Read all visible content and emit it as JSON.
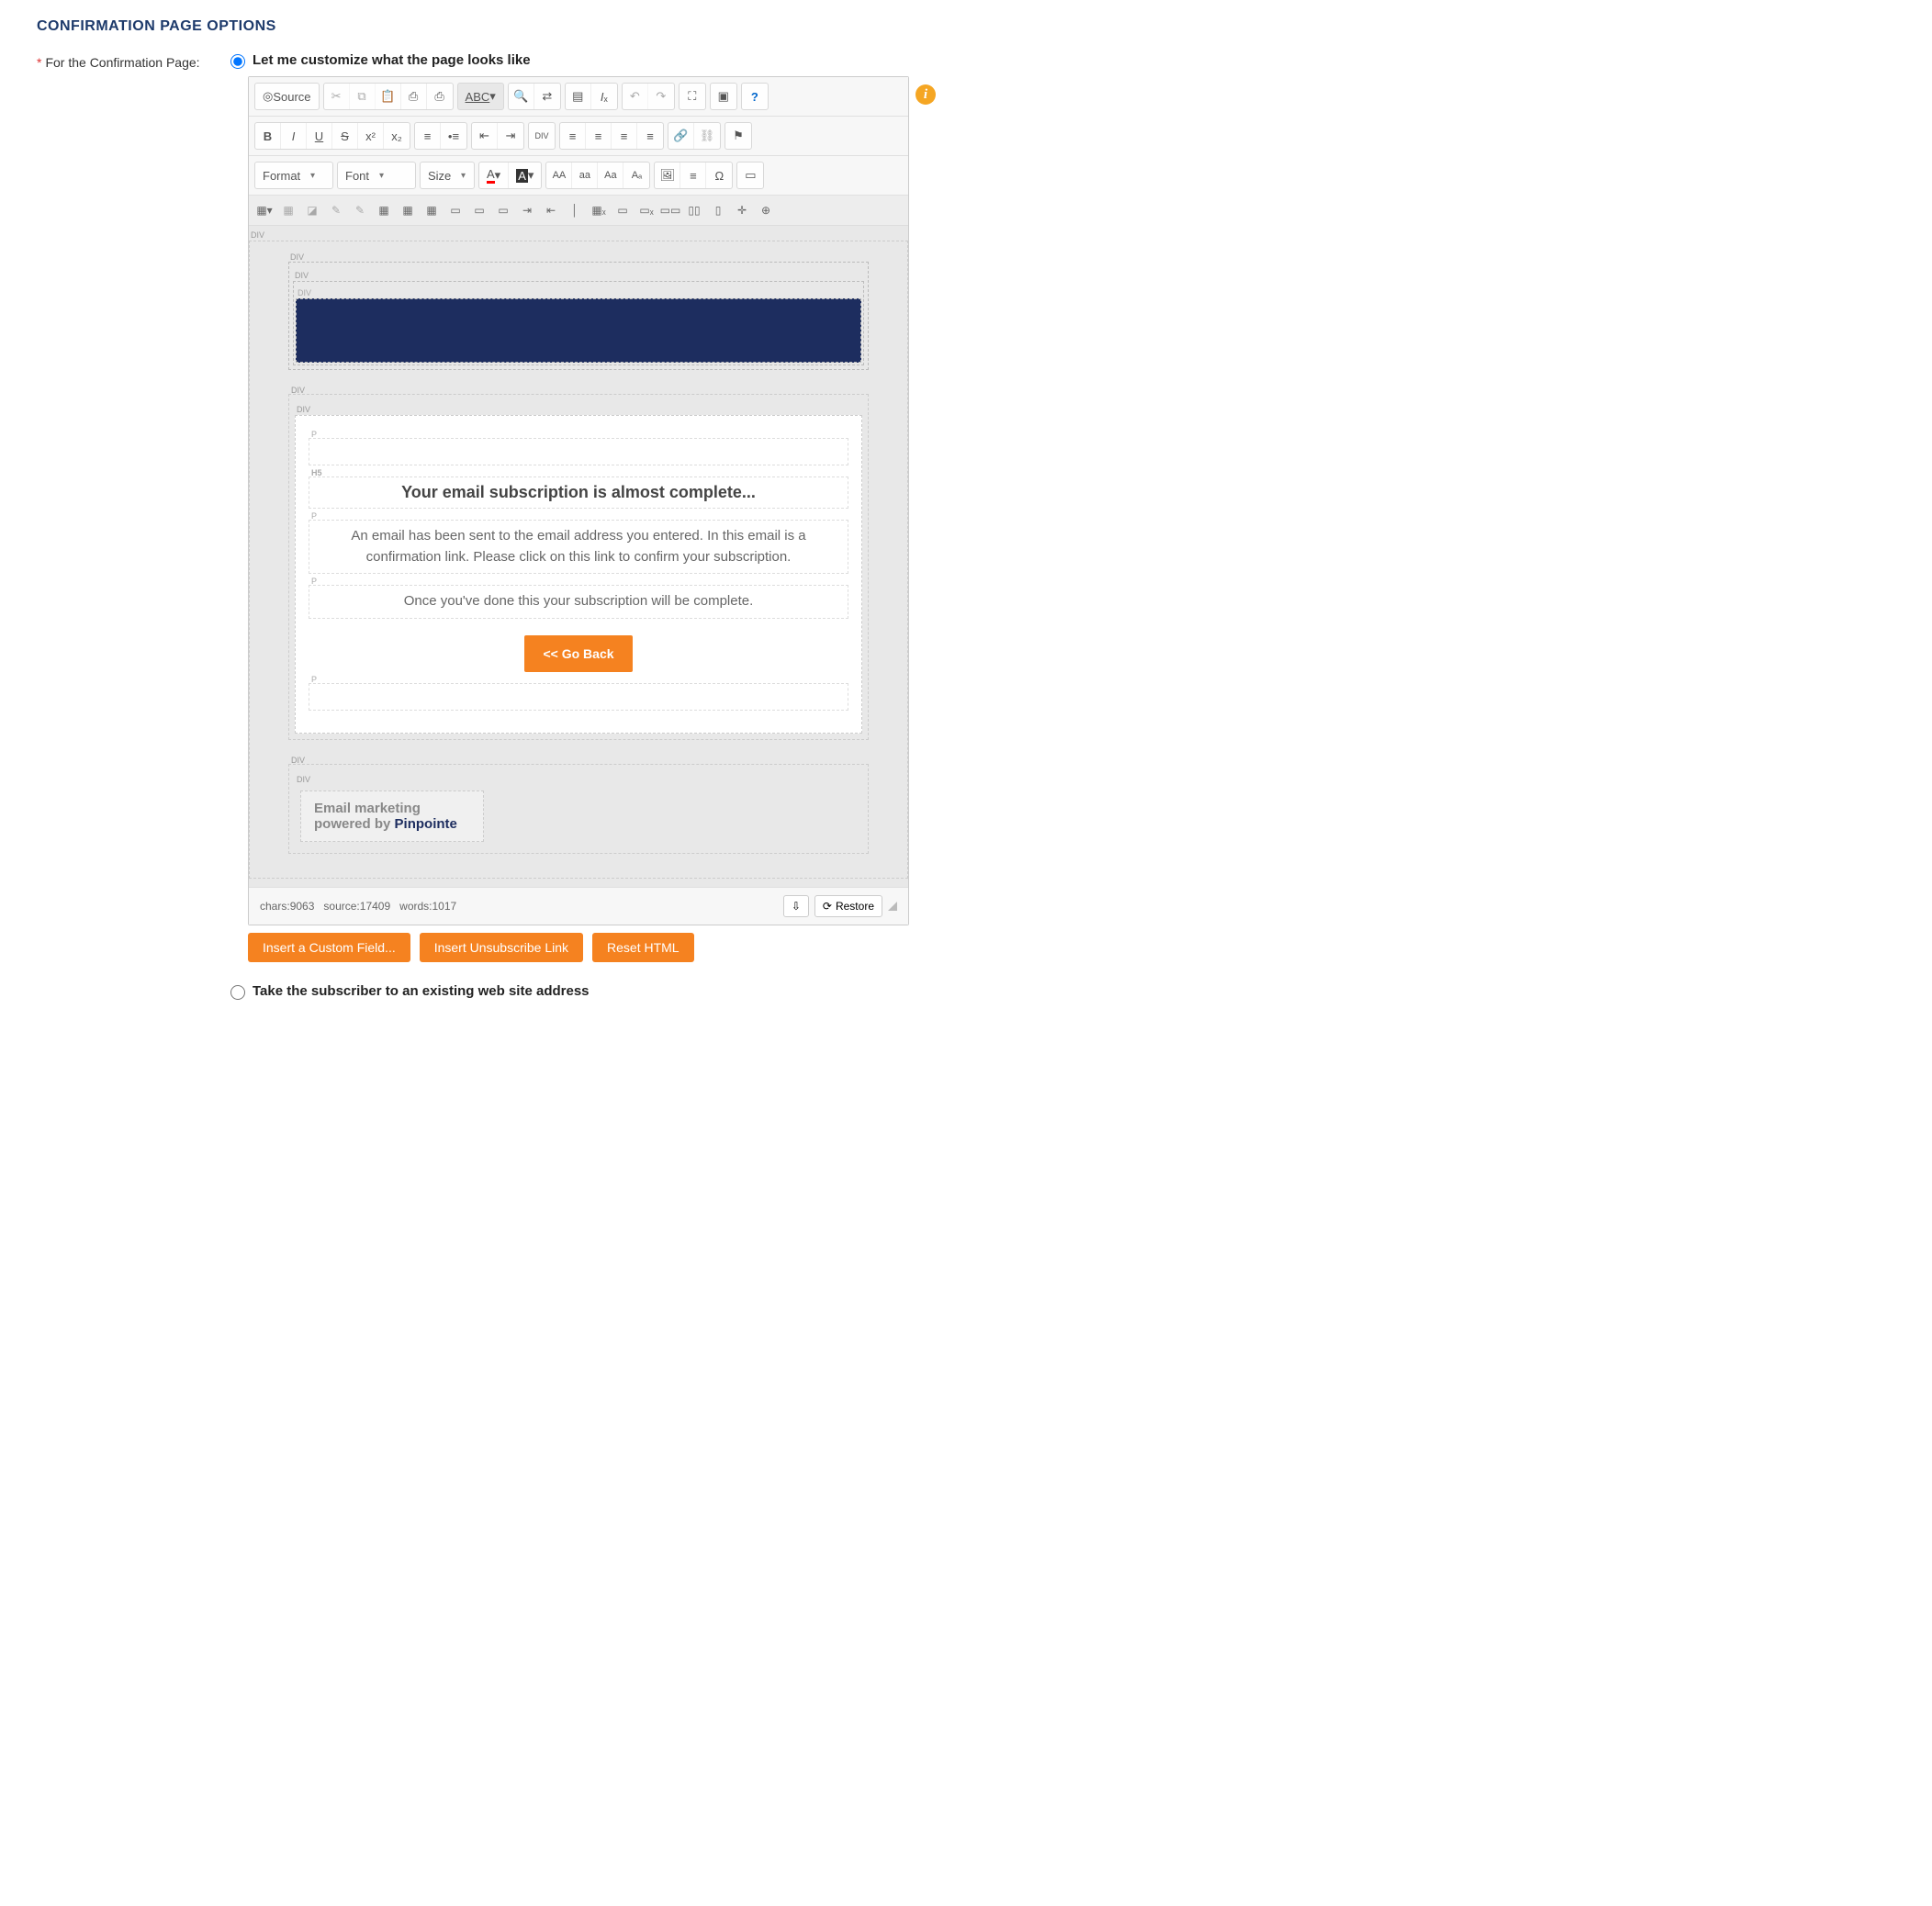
{
  "section_title": "CONFIRMATION PAGE OPTIONS",
  "label": "For the Confirmation Page:",
  "radios": {
    "customize": "Let me customize what the page looks like",
    "existing": "Take the subscriber to an existing web site address"
  },
  "toolbar": {
    "source": "Source",
    "format": "Format",
    "font": "Font",
    "size": "Size",
    "spellcheck": "ABC",
    "restore": "Restore"
  },
  "stats": {
    "chars_label": "chars:",
    "chars": "9063",
    "source_label": "source:",
    "source": "17409",
    "words_label": "words:",
    "words": "1017"
  },
  "content": {
    "h5": "Your email subscription is almost complete...",
    "p1": "An email has been sent to the email address you entered. In this email is a confirmation link. Please click on this link to confirm your subscription.",
    "p2": "Once you've done this your subscription will be complete.",
    "go_back": "<< Go Back",
    "footer1": "Email marketing powered by ",
    "footer2": "Pinpointe"
  },
  "buttons": {
    "custom_field": "Insert a Custom Field...",
    "unsub": "Insert Unsubscribe Link",
    "reset": "Reset HTML"
  },
  "tags": {
    "div": "DIV",
    "p": "P",
    "h5": "H5"
  },
  "help_badge": "i"
}
